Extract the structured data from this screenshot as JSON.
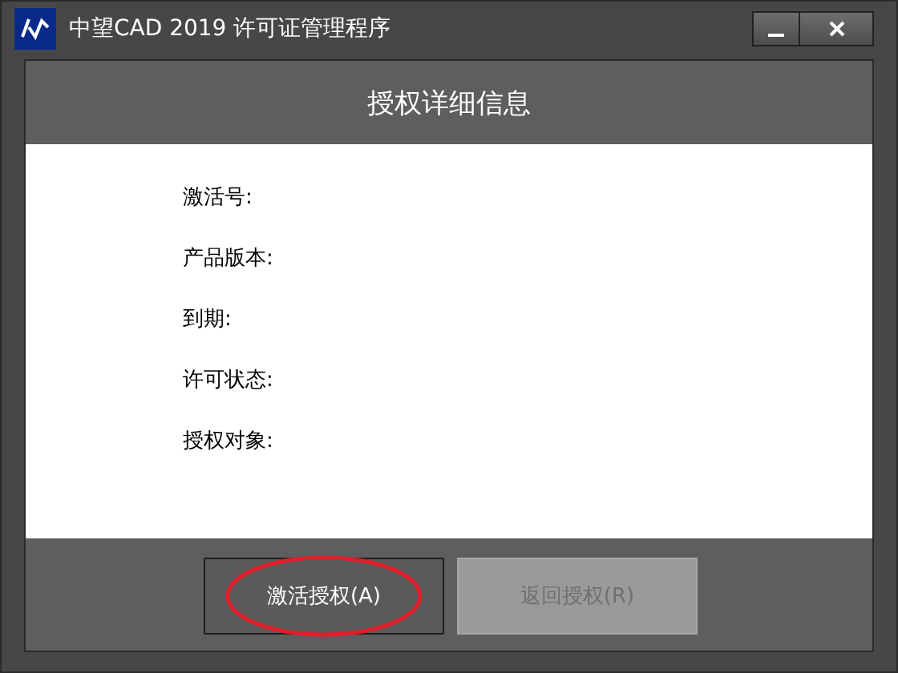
{
  "window": {
    "title": "中望CAD 2019 许可证管理程序"
  },
  "header": "授权详细信息",
  "fields": [
    {
      "label": "激活号:"
    },
    {
      "label": "产品版本:"
    },
    {
      "label": "到期:"
    },
    {
      "label": "许可状态:"
    },
    {
      "label": "授权对象:"
    }
  ],
  "buttons": [
    {
      "label": "激活授权(A)",
      "disabled": false,
      "highlighted": true
    },
    {
      "label": "返回授权(R)",
      "disabled": true,
      "highlighted": false
    }
  ]
}
